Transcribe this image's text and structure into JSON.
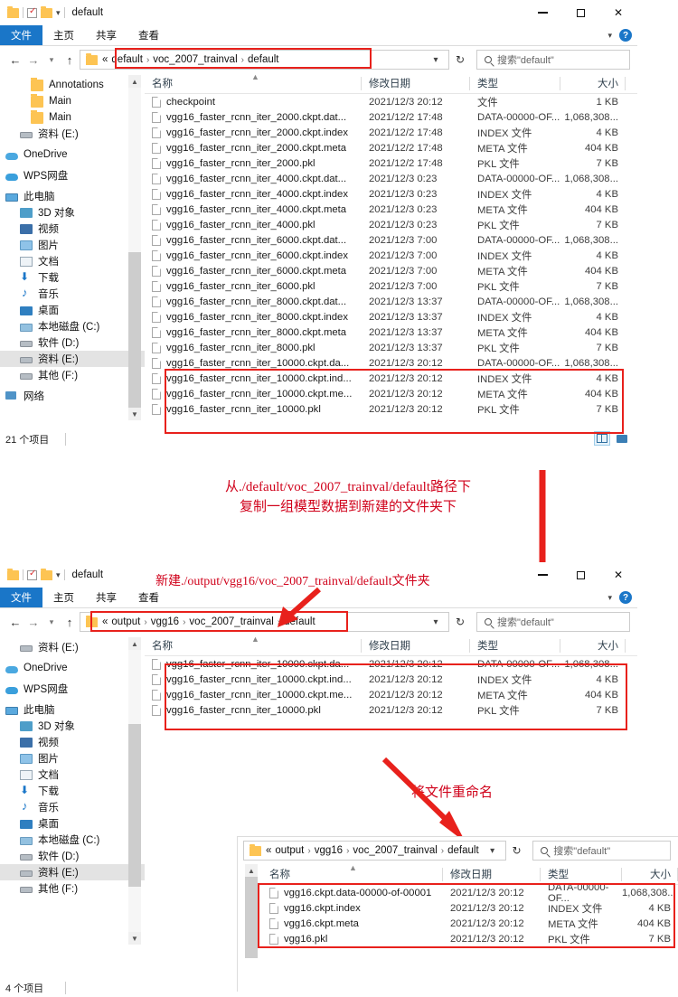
{
  "window1": {
    "title": "default",
    "ribbon_tabs": [
      "文件",
      "主页",
      "共享",
      "查看"
    ],
    "breadcrumbs": [
      "«",
      "default",
      "voc_2007_trainval",
      "default"
    ],
    "search_placeholder": "搜索\"default\"",
    "columns": [
      "名称",
      "修改日期",
      "类型",
      "大小"
    ],
    "nav_items": [
      {
        "label": "Annotations",
        "icon": "folder-icon",
        "indent": 2,
        "selected": false
      },
      {
        "label": "Main",
        "icon": "folder-icon",
        "indent": 2,
        "selected": false
      },
      {
        "label": "Main",
        "icon": "folder-icon",
        "indent": 2,
        "selected": false
      },
      {
        "label": "资料 (E:)",
        "icon": "drive-icon",
        "indent": 1,
        "selected": false
      },
      {
        "label": "OneDrive",
        "icon": "onedrive-icon",
        "indent": 0,
        "selected": false,
        "gap": true
      },
      {
        "label": "WPS网盘",
        "icon": "wps-cloud-icon",
        "indent": 0,
        "selected": false,
        "gap": true
      },
      {
        "label": "此电脑",
        "icon": "this-pc-icon",
        "indent": 0,
        "selected": false,
        "gap": true
      },
      {
        "label": "3D 对象",
        "icon": "3d-objects-icon",
        "indent": 1,
        "selected": false
      },
      {
        "label": "视频",
        "icon": "videos-icon",
        "indent": 1,
        "selected": false
      },
      {
        "label": "图片",
        "icon": "pictures-icon",
        "indent": 1,
        "selected": false
      },
      {
        "label": "文档",
        "icon": "documents-icon",
        "indent": 1,
        "selected": false
      },
      {
        "label": "下载",
        "icon": "downloads-icon",
        "indent": 1,
        "selected": false
      },
      {
        "label": "音乐",
        "icon": "music-icon",
        "indent": 1,
        "selected": false
      },
      {
        "label": "桌面",
        "icon": "desktop-icon",
        "indent": 1,
        "selected": false
      },
      {
        "label": "本地磁盘 (C:)",
        "icon": "hdd-icon",
        "indent": 1,
        "selected": false
      },
      {
        "label": "软件 (D:)",
        "icon": "drive-icon",
        "indent": 1,
        "selected": false
      },
      {
        "label": "资料 (E:)",
        "icon": "drive-icon",
        "indent": 1,
        "selected": true
      },
      {
        "label": "其他 (F:)",
        "icon": "drive-icon",
        "indent": 1,
        "selected": false
      },
      {
        "label": "网络",
        "icon": "network-icon",
        "indent": 0,
        "selected": false,
        "gap": true
      }
    ],
    "files": [
      {
        "name": "checkpoint",
        "date": "2021/12/3 20:12",
        "type": "文件",
        "size": "1 KB"
      },
      {
        "name": "vgg16_faster_rcnn_iter_2000.ckpt.dat...",
        "date": "2021/12/2 17:48",
        "type": "DATA-00000-OF...",
        "size": "1,068,308..."
      },
      {
        "name": "vgg16_faster_rcnn_iter_2000.ckpt.index",
        "date": "2021/12/2 17:48",
        "type": "INDEX 文件",
        "size": "4 KB"
      },
      {
        "name": "vgg16_faster_rcnn_iter_2000.ckpt.meta",
        "date": "2021/12/2 17:48",
        "type": "META 文件",
        "size": "404 KB"
      },
      {
        "name": "vgg16_faster_rcnn_iter_2000.pkl",
        "date": "2021/12/2 17:48",
        "type": "PKL 文件",
        "size": "7 KB"
      },
      {
        "name": "vgg16_faster_rcnn_iter_4000.ckpt.dat...",
        "date": "2021/12/3 0:23",
        "type": "DATA-00000-OF...",
        "size": "1,068,308..."
      },
      {
        "name": "vgg16_faster_rcnn_iter_4000.ckpt.index",
        "date": "2021/12/3 0:23",
        "type": "INDEX 文件",
        "size": "4 KB"
      },
      {
        "name": "vgg16_faster_rcnn_iter_4000.ckpt.meta",
        "date": "2021/12/3 0:23",
        "type": "META 文件",
        "size": "404 KB"
      },
      {
        "name": "vgg16_faster_rcnn_iter_4000.pkl",
        "date": "2021/12/3 0:23",
        "type": "PKL 文件",
        "size": "7 KB"
      },
      {
        "name": "vgg16_faster_rcnn_iter_6000.ckpt.dat...",
        "date": "2021/12/3 7:00",
        "type": "DATA-00000-OF...",
        "size": "1,068,308..."
      },
      {
        "name": "vgg16_faster_rcnn_iter_6000.ckpt.index",
        "date": "2021/12/3 7:00",
        "type": "INDEX 文件",
        "size": "4 KB"
      },
      {
        "name": "vgg16_faster_rcnn_iter_6000.ckpt.meta",
        "date": "2021/12/3 7:00",
        "type": "META 文件",
        "size": "404 KB"
      },
      {
        "name": "vgg16_faster_rcnn_iter_6000.pkl",
        "date": "2021/12/3 7:00",
        "type": "PKL 文件",
        "size": "7 KB"
      },
      {
        "name": "vgg16_faster_rcnn_iter_8000.ckpt.dat...",
        "date": "2021/12/3 13:37",
        "type": "DATA-00000-OF...",
        "size": "1,068,308..."
      },
      {
        "name": "vgg16_faster_rcnn_iter_8000.ckpt.index",
        "date": "2021/12/3 13:37",
        "type": "INDEX 文件",
        "size": "4 KB"
      },
      {
        "name": "vgg16_faster_rcnn_iter_8000.ckpt.meta",
        "date": "2021/12/3 13:37",
        "type": "META 文件",
        "size": "404 KB"
      },
      {
        "name": "vgg16_faster_rcnn_iter_8000.pkl",
        "date": "2021/12/3 13:37",
        "type": "PKL 文件",
        "size": "7 KB"
      },
      {
        "name": "vgg16_faster_rcnn_iter_10000.ckpt.da...",
        "date": "2021/12/3 20:12",
        "type": "DATA-00000-OF...",
        "size": "1,068,308..."
      },
      {
        "name": "vgg16_faster_rcnn_iter_10000.ckpt.ind...",
        "date": "2021/12/3 20:12",
        "type": "INDEX 文件",
        "size": "4 KB"
      },
      {
        "name": "vgg16_faster_rcnn_iter_10000.ckpt.me...",
        "date": "2021/12/3 20:12",
        "type": "META 文件",
        "size": "404 KB"
      },
      {
        "name": "vgg16_faster_rcnn_iter_10000.pkl",
        "date": "2021/12/3 20:12",
        "type": "PKL 文件",
        "size": "7 KB"
      }
    ],
    "status": "21 个项目"
  },
  "window2": {
    "title": "default",
    "ribbon_tabs": [
      "文件",
      "主页",
      "共享",
      "查看"
    ],
    "breadcrumbs": [
      "«",
      "output",
      "vgg16",
      "voc_2007_trainval",
      "default"
    ],
    "search_placeholder": "搜索\"default\"",
    "columns": [
      "名称",
      "修改日期",
      "类型",
      "大小"
    ],
    "nav_items": [
      {
        "label": "资料 (E:)",
        "icon": "drive-icon",
        "indent": 1,
        "selected": false
      },
      {
        "label": "OneDrive",
        "icon": "onedrive-icon",
        "indent": 0,
        "selected": false,
        "gap": true
      },
      {
        "label": "WPS网盘",
        "icon": "wps-cloud-icon",
        "indent": 0,
        "selected": false,
        "gap": true
      },
      {
        "label": "此电脑",
        "icon": "this-pc-icon",
        "indent": 0,
        "selected": false,
        "gap": true
      },
      {
        "label": "3D 对象",
        "icon": "3d-objects-icon",
        "indent": 1,
        "selected": false
      },
      {
        "label": "视频",
        "icon": "videos-icon",
        "indent": 1,
        "selected": false
      },
      {
        "label": "图片",
        "icon": "pictures-icon",
        "indent": 1,
        "selected": false
      },
      {
        "label": "文档",
        "icon": "documents-icon",
        "indent": 1,
        "selected": false
      },
      {
        "label": "下载",
        "icon": "downloads-icon",
        "indent": 1,
        "selected": false
      },
      {
        "label": "音乐",
        "icon": "music-icon",
        "indent": 1,
        "selected": false
      },
      {
        "label": "桌面",
        "icon": "desktop-icon",
        "indent": 1,
        "selected": false
      },
      {
        "label": "本地磁盘 (C:)",
        "icon": "hdd-icon",
        "indent": 1,
        "selected": false
      },
      {
        "label": "软件 (D:)",
        "icon": "drive-icon",
        "indent": 1,
        "selected": false
      },
      {
        "label": "资料 (E:)",
        "icon": "drive-icon",
        "indent": 1,
        "selected": true
      },
      {
        "label": "其他 (F:)",
        "icon": "drive-icon",
        "indent": 1,
        "selected": false
      }
    ],
    "files": [
      {
        "name": "vgg16_faster_rcnn_iter_10000.ckpt.da...",
        "date": "2021/12/3 20:12",
        "type": "DATA-00000-OF...",
        "size": "1,068,308..."
      },
      {
        "name": "vgg16_faster_rcnn_iter_10000.ckpt.ind...",
        "date": "2021/12/3 20:12",
        "type": "INDEX 文件",
        "size": "4 KB"
      },
      {
        "name": "vgg16_faster_rcnn_iter_10000.ckpt.me...",
        "date": "2021/12/3 20:12",
        "type": "META 文件",
        "size": "404 KB"
      },
      {
        "name": "vgg16_faster_rcnn_iter_10000.pkl",
        "date": "2021/12/3 20:12",
        "type": "PKL 文件",
        "size": "7 KB"
      }
    ],
    "status": "4 个项目"
  },
  "window3": {
    "breadcrumbs": [
      "«",
      "output",
      "vgg16",
      "voc_2007_trainval",
      "default"
    ],
    "search_placeholder": "搜索\"default\"",
    "columns": [
      "名称",
      "修改日期",
      "类型",
      "大小"
    ],
    "files": [
      {
        "name": "vgg16.ckpt.data-00000-of-00001",
        "date": "2021/12/3 20:12",
        "type": "DATA-00000-OF...",
        "size": "1,068,308..."
      },
      {
        "name": "vgg16.ckpt.index",
        "date": "2021/12/3 20:12",
        "type": "INDEX 文件",
        "size": "4 KB"
      },
      {
        "name": "vgg16.ckpt.meta",
        "date": "2021/12/3 20:12",
        "type": "META 文件",
        "size": "404 KB"
      },
      {
        "name": "vgg16.pkl",
        "date": "2021/12/3 20:12",
        "type": "PKL 文件",
        "size": "7 KB"
      }
    ]
  },
  "annotations": {
    "copy_note_line1": "从./default/voc_2007_trainval/default路径下",
    "copy_note_line2": "复制一组模型数据到新建的文件夹下",
    "create_note": "新建./output/vgg16/voc_2007_trainval/default文件夹",
    "rename_note": "将文件重命名"
  },
  "colors": {
    "accent": "#1a76c8",
    "annotation_red": "#d0021b",
    "box_red": "#e8211c",
    "folder_yellow": "#fdc453"
  }
}
